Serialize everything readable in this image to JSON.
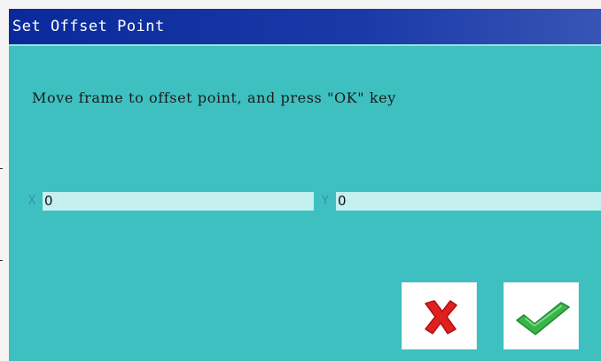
{
  "dialog": {
    "title": "Set Offset Point",
    "message": "Move frame to offset point, and press \"OK\" key"
  },
  "fields": {
    "x": {
      "label": "X",
      "value": "0"
    },
    "y": {
      "label": "Y",
      "value": "0"
    }
  },
  "buttons": {
    "cancel": {
      "icon": "red-x-cancel-icon",
      "color": "#e02020"
    },
    "ok": {
      "icon": "green-check-ok-icon",
      "color": "#39b54a"
    }
  },
  "colors": {
    "title_bar": "#0a2a9c",
    "dialog_background": "#3ec0c0",
    "field_background": "#c5f0f0"
  }
}
